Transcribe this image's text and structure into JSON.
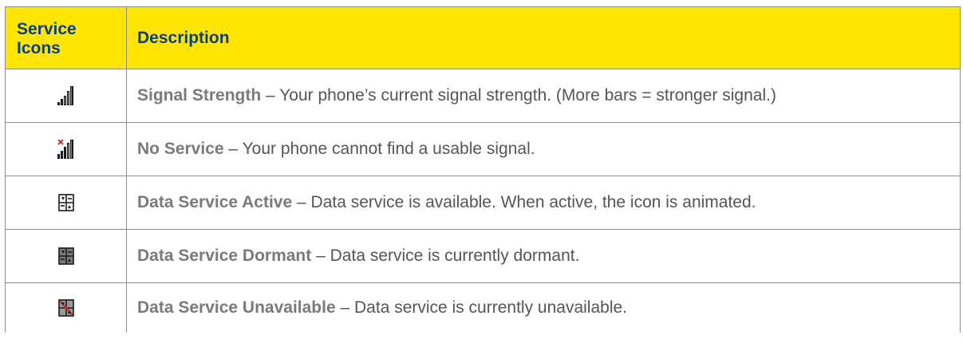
{
  "table": {
    "headers": {
      "icons": "Service Icons",
      "icons_line1": "Service",
      "icons_line2": "Icons",
      "description": "Description"
    },
    "rows": [
      {
        "icon": "signal-strength-icon",
        "name": "Signal Strength",
        "separator": "–",
        "text": "Your phone’s current signal strength. (More bars = stronger signal.)"
      },
      {
        "icon": "no-service-icon",
        "name": "No Service",
        "separator": "–",
        "text": "Your phone cannot find a usable signal."
      },
      {
        "icon": "data-service-active-icon",
        "name": "Data Service Active",
        "separator": "–",
        "text": "Data service is available. When active, the icon is animated."
      },
      {
        "icon": "data-service-dormant-icon",
        "name": "Data Service Dormant",
        "separator": "–",
        "text": "Data service is currently dormant."
      },
      {
        "icon": "data-service-unavailable-icon",
        "name": "Data Service Unavailable",
        "separator": "–",
        "text": "Data service is currently unavailable."
      }
    ]
  },
  "colors": {
    "header_background": "#ffe600",
    "header_text": "#0b3f7f",
    "service_name_text": "#7a7a7a",
    "body_text": "#555555",
    "border": "#8c8c8c",
    "no_service_mark": "#c0392b"
  }
}
